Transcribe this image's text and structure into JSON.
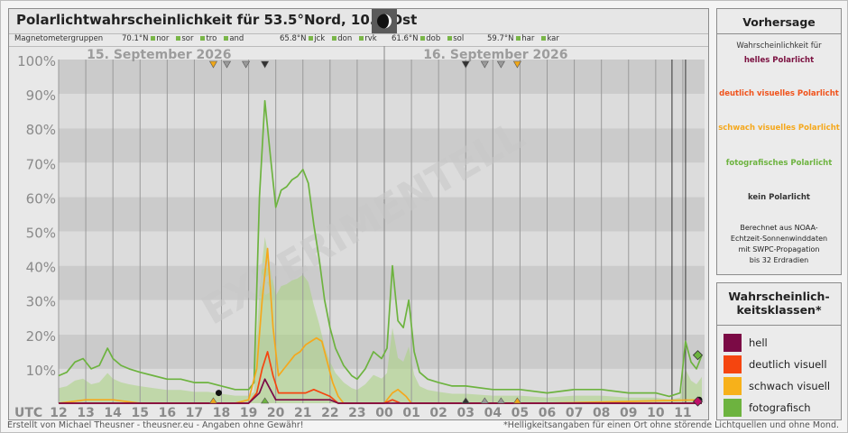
{
  "header": {
    "title": "Polarlichtwahrscheinlichkeit für  53.5°Nord, 10.0°Ost",
    "magnetometer_label": "Magnetometergruppen",
    "groups": [
      {
        "lat": "70.1°N",
        "stations": [
          "nor",
          "sor",
          "tro",
          "and"
        ]
      },
      {
        "lat": "65.8°N",
        "stations": [
          "jck",
          "don",
          "rvk"
        ]
      },
      {
        "lat": "61.6°N",
        "stations": [
          "dob",
          "sol"
        ]
      },
      {
        "lat": "59.7°N",
        "stations": [
          "har",
          "kar"
        ]
      }
    ],
    "moon_icon": "moon-phase-icon"
  },
  "sidebar": {
    "forecast_title": "Vorhersage",
    "forecast_items": [
      {
        "text": "Wahrscheinlichkeit für",
        "color": "#333333"
      },
      {
        "text": "helles Polarlicht",
        "color": "#7b1040"
      },
      {
        "text": "deutlich visuelles Polarlicht",
        "color": "#f0531c"
      },
      {
        "text": "schwach visuelles Polarlicht",
        "color": "#f5a81c"
      },
      {
        "text": "fotografisches Polarlicht",
        "color": "#6db33f"
      },
      {
        "text": "kein Polarlicht",
        "color": "#333333"
      }
    ],
    "note_lines": [
      "Berechnet aus NOAA-",
      "Echtzeit-Sonnenwinddaten",
      "mit SWPC-Propagation",
      "bis 32 Erdradien"
    ],
    "classes_title_lines": [
      "Wahrscheinlich-",
      "keitsklassen*"
    ],
    "classes": [
      {
        "label": "hell",
        "color": "#7b0a45"
      },
      {
        "label": "deutlich visuell",
        "color": "#f5450f"
      },
      {
        "label": "schwach visuell",
        "color": "#f7b11a"
      },
      {
        "label": "fotografisch",
        "color": "#6db33f"
      }
    ]
  },
  "footer": {
    "left": "Erstellt von Michael Theusner - theusner.eu - Angaben ohne Gewähr!",
    "right": "*Helligkeitsangaben für einen Ort ohne störende Lichtquellen und ohne Mond."
  },
  "chart_data": {
    "type": "line",
    "dates": [
      "15. September 2026",
      "16. September 2026"
    ],
    "watermark": "EXPERIMENTELL",
    "ylim": [
      0,
      100
    ],
    "yticks": [
      "100%",
      "90%",
      "80%",
      "70%",
      "60%",
      "50%",
      "40%",
      "30%",
      "20%",
      "10%"
    ],
    "xlabel": "UTC",
    "xlim": [
      12,
      35.8
    ],
    "xticks": [
      "12",
      "13",
      "14",
      "15",
      "16",
      "17",
      "18",
      "19",
      "20",
      "21",
      "22",
      "23",
      "00",
      "01",
      "02",
      "03",
      "04",
      "05",
      "06",
      "07",
      "08",
      "09",
      "10",
      "11"
    ],
    "series": [
      {
        "name": "fotografisch",
        "color": "#6db33f",
        "x": [
          12.0,
          12.3,
          12.6,
          12.9,
          13.2,
          13.5,
          13.8,
          14.0,
          14.3,
          14.6,
          15.0,
          15.5,
          16.0,
          16.5,
          17.0,
          17.5,
          18.0,
          18.5,
          19.0,
          19.2,
          19.4,
          19.6,
          19.8,
          20.0,
          20.2,
          20.4,
          20.6,
          20.8,
          21.0,
          21.2,
          21.4,
          21.6,
          21.8,
          22.0,
          22.2,
          22.5,
          22.8,
          23.0,
          23.3,
          23.6,
          23.9,
          24.1,
          24.3,
          24.5,
          24.7,
          24.9,
          25.1,
          25.3,
          25.6,
          26.0,
          26.5,
          27.0,
          28.0,
          29.0,
          30.0,
          31.0,
          32.0,
          33.0,
          34.0,
          34.5,
          34.9,
          35.1,
          35.3,
          35.5,
          35.7
        ],
        "y": [
          8,
          9,
          12,
          13,
          10,
          11,
          16,
          13,
          11,
          10,
          9,
          8,
          7,
          7,
          6,
          6,
          5,
          4,
          4,
          6,
          60,
          88,
          72,
          57,
          62,
          63,
          65,
          66,
          68,
          64,
          52,
          42,
          30,
          22,
          16,
          11,
          8,
          7,
          10,
          15,
          13,
          16,
          40,
          24,
          22,
          30,
          15,
          9,
          7,
          6,
          5,
          5,
          4,
          4,
          3,
          4,
          4,
          3,
          3,
          2,
          3,
          18,
          12,
          10,
          14
        ]
      },
      {
        "name": "schwach visuell",
        "color": "#f5a81c",
        "x": [
          12.0,
          13.0,
          14.0,
          15.0,
          16.0,
          17.0,
          18.0,
          18.5,
          19.0,
          19.3,
          19.5,
          19.7,
          19.9,
          20.1,
          20.3,
          20.5,
          20.7,
          20.9,
          21.1,
          21.3,
          21.5,
          21.7,
          21.9,
          22.1,
          22.3,
          22.5,
          23.0,
          24.0,
          24.3,
          24.5,
          24.8,
          25.0,
          25.5,
          26.0,
          30.0,
          35.7
        ],
        "y": [
          0,
          1,
          1,
          0,
          0,
          0,
          0,
          0,
          1,
          10,
          30,
          45,
          22,
          8,
          10,
          12,
          14,
          15,
          17,
          18,
          19,
          18,
          12,
          6,
          2,
          0,
          0,
          0,
          3,
          4,
          2,
          0,
          0,
          0,
          0,
          1
        ]
      },
      {
        "name": "deutlich visuell",
        "color": "#f5450f",
        "x": [
          12.0,
          18.0,
          19.0,
          19.3,
          19.5,
          19.7,
          19.9,
          20.1,
          20.3,
          20.5,
          20.8,
          21.1,
          21.4,
          21.7,
          22.0,
          22.3,
          24.0,
          24.3,
          24.6,
          35.7
        ],
        "y": [
          0,
          0,
          0,
          3,
          10,
          15,
          8,
          3,
          3,
          3,
          3,
          3,
          4,
          3,
          2,
          0,
          0,
          1,
          0,
          0
        ]
      },
      {
        "name": "hell",
        "color": "#7b0a45",
        "x": [
          12.0,
          18.0,
          19.0,
          19.4,
          19.6,
          19.8,
          20.0,
          20.3,
          20.6,
          21.0,
          21.5,
          22.0,
          22.3,
          35.7
        ],
        "y": [
          0,
          0,
          0,
          3,
          7,
          4,
          1,
          1,
          1,
          1,
          1,
          1,
          0,
          0
        ]
      }
    ],
    "grid": true
  }
}
